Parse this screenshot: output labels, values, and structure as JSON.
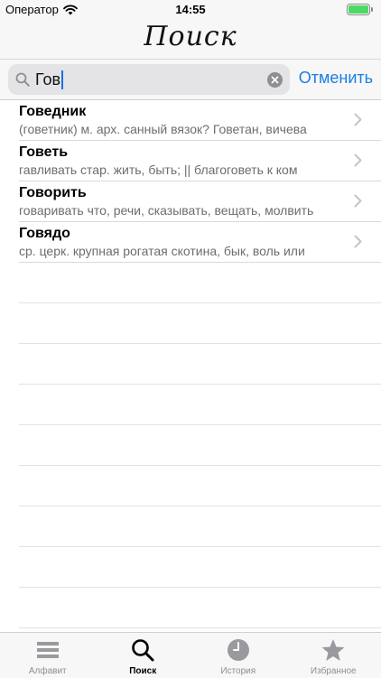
{
  "status_bar": {
    "carrier": "Оператор",
    "time": "14:55"
  },
  "nav": {
    "title": "Поиск"
  },
  "search": {
    "value": "Гов",
    "cancel_label": "Отменить"
  },
  "results": [
    {
      "title": "Говедник",
      "subtitle": "(говетник) м. арх. санный вязок? Говетан, вичева"
    },
    {
      "title": "Говеть",
      "subtitle": "гавливать стар. жить, быть; || благоговеть к ком"
    },
    {
      "title": "Говорить",
      "subtitle": "говаривать что, речи, сказывать, вещать, молвить"
    },
    {
      "title": "Говядо",
      "subtitle": "ср. церк. крупная рогатая скотина, бык, воль или"
    }
  ],
  "tabs": [
    {
      "label": "Алфавит",
      "icon": "list-icon",
      "active": false
    },
    {
      "label": "Поиск",
      "icon": "search-icon",
      "active": true
    },
    {
      "label": "История",
      "icon": "clock-icon",
      "active": false
    },
    {
      "label": "Избранное",
      "icon": "star-icon",
      "active": false
    }
  ],
  "colors": {
    "accent": "#1a7fe3",
    "battery": "#4cd964",
    "inactive": "#8e8e93"
  }
}
